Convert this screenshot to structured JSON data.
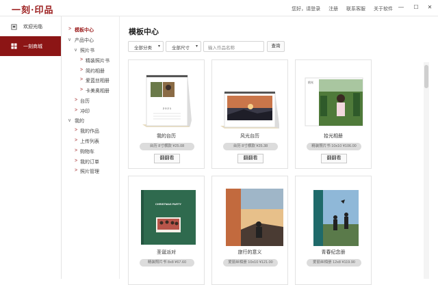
{
  "app": {
    "logo": "一刻·印品"
  },
  "toplinks": [
    "您好，请登录",
    "注册",
    "联系客服",
    "关于软件"
  ],
  "window": {
    "minimize": "—",
    "maximize": "☐",
    "close": "✕"
  },
  "leftnav": [
    {
      "label": "欢迎光临",
      "icon": "home-icon"
    },
    {
      "label": "一刻商城",
      "icon": "grid-icon"
    }
  ],
  "tree": {
    "template_center": "模板中心",
    "product_center": "产品中心",
    "photobook": "照片书",
    "photobook_children": [
      "精装照片书",
      "简约相册",
      "爱蓝丝相册",
      "卡美奥相册"
    ],
    "calendar": "台历",
    "print": "冲印",
    "mine": "我的",
    "mine_children": [
      "我的作品",
      "上传列表",
      "购物车",
      "我的订单",
      "照片管理"
    ]
  },
  "main": {
    "title": "模板中心",
    "filter_category": "全部分类",
    "filter_size": "全部尺寸",
    "search_placeholder": "输入作品名称",
    "search_button": "查询",
    "button_label": "翻翻看"
  },
  "cards": [
    {
      "name": "我的台历",
      "meta": "台历 8寸横款 ¥25.08"
    },
    {
      "name": "风光台历",
      "meta": "台历 8寸横款 ¥25.38"
    },
    {
      "name": "拾光相册",
      "meta": "精装照片书 10x10 ¥106.00"
    },
    {
      "name": "圣诞派对",
      "meta": "精装照片书 8x8 ¥67.60"
    },
    {
      "name": "旅行的意义",
      "meta": "爱丽丝相册 10x10 ¥121.00"
    },
    {
      "name": "青春纪念册",
      "meta": "爱丽丝相册 12x8 ¥119.90"
    }
  ],
  "thumb_text": {
    "calendar_year": "2 0 2 1",
    "christmas": "CHRISTMAS PARTY",
    "album_caption": "拾光"
  },
  "colors": {
    "brand": "#8c1515",
    "accent_text": "#9b1c1c"
  }
}
